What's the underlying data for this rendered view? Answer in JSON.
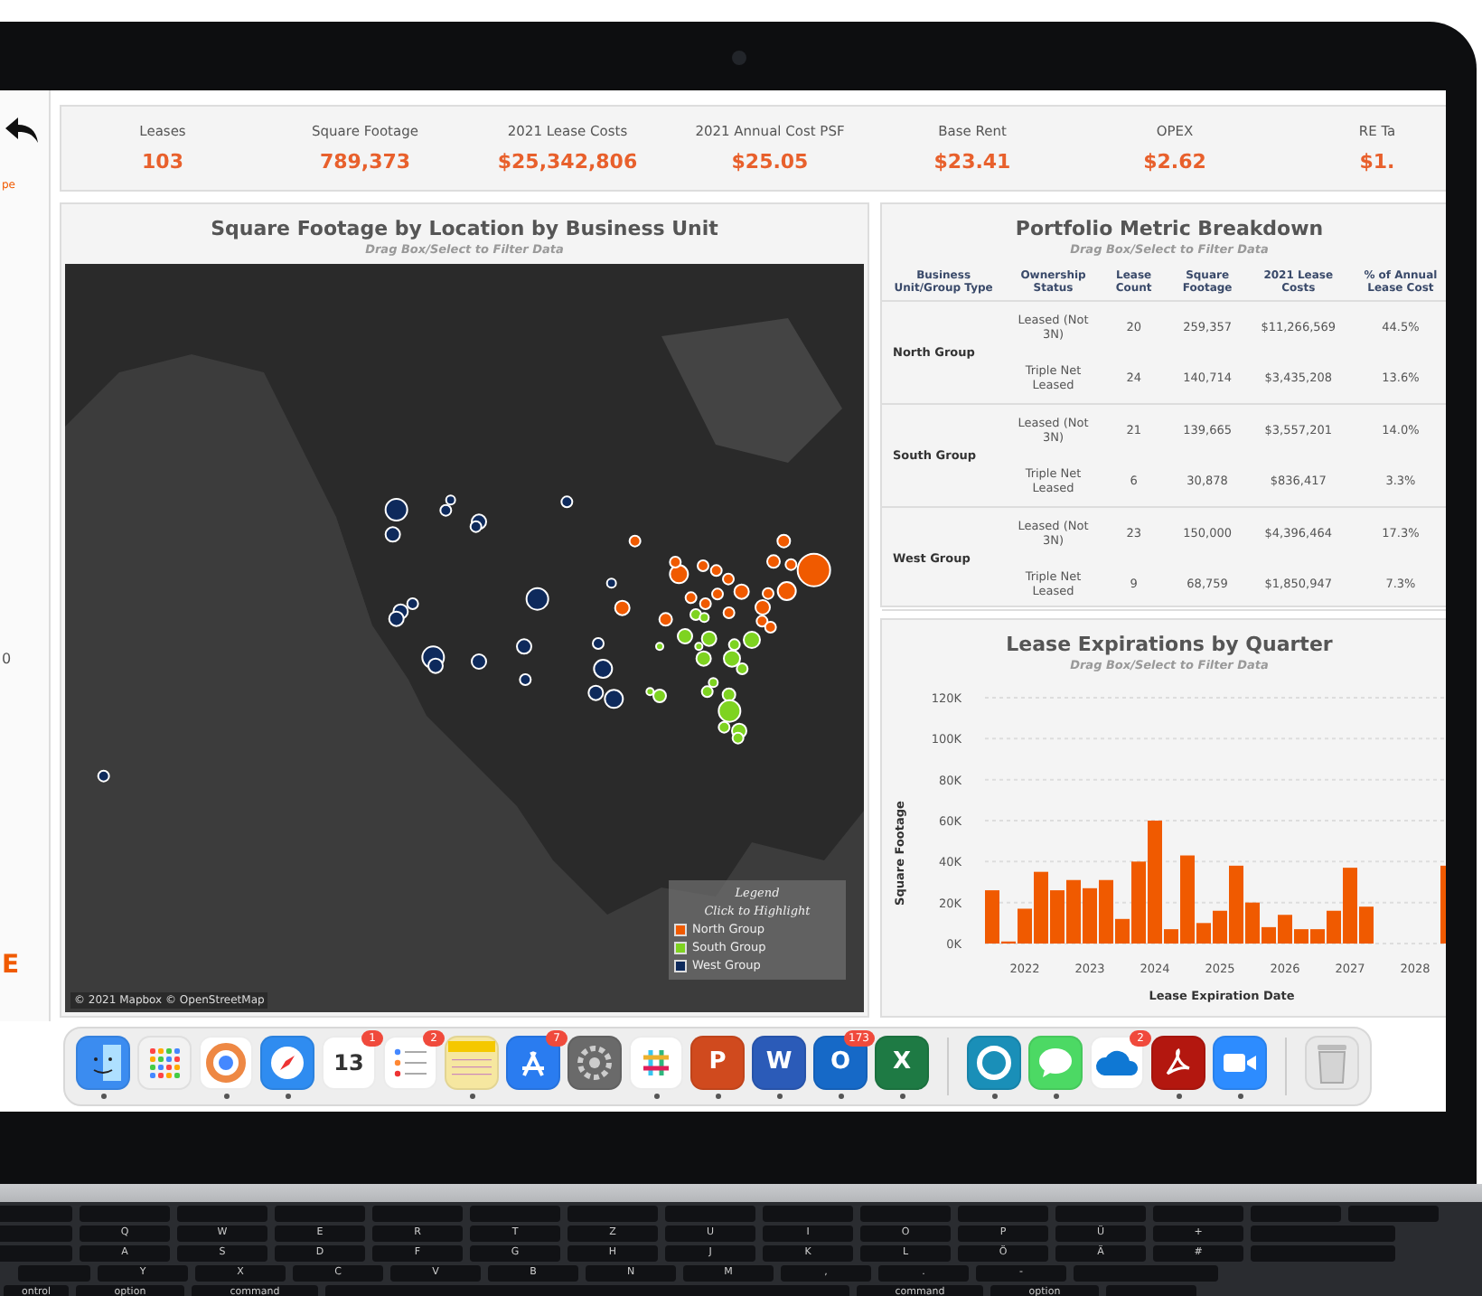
{
  "sidebar": {
    "texts": [
      {
        "text": "pe",
        "kind": "small"
      },
      {
        "text": "0",
        "kind": "plain"
      },
      {
        "text": "E",
        "kind": "big"
      }
    ]
  },
  "kpis": [
    {
      "label": "Leases",
      "value": "103"
    },
    {
      "label": "Square Footage",
      "value": "789,373"
    },
    {
      "label": "2021 Lease Costs",
      "value": "$25,342,806"
    },
    {
      "label": "2021 Annual Cost PSF",
      "value": "$25.05"
    },
    {
      "label": "Base Rent",
      "value": "$23.41"
    },
    {
      "label": "OPEX",
      "value": "$2.62"
    },
    {
      "label": "RE Ta",
      "value": "$1."
    }
  ],
  "map": {
    "title": "Square Footage by Location by Business Unit",
    "subtitle": "Drag Box/Select to Filter Data",
    "attribution": "© 2021 Mapbox © OpenStreetMap",
    "legend": {
      "title": "Legend",
      "hint": "Click to Highlight",
      "items": [
        {
          "label": "North Group",
          "color": "#f05a00"
        },
        {
          "label": "South Group",
          "color": "#7ed321"
        },
        {
          "label": "West Group",
          "color": "#0e2a5c"
        }
      ]
    }
  },
  "table": {
    "title": "Portfolio Metric Breakdown",
    "subtitle": "Drag Box/Select to Filter Data",
    "columns": [
      "Business Unit/Group Type",
      "Ownership Status",
      "Lease Count",
      "Square Footage",
      "2021 Lease Costs",
      "% of Annual Lease Cost"
    ],
    "groups": [
      {
        "name": "North Group",
        "rows": [
          [
            "Leased (Not 3N)",
            "20",
            "259,357",
            "$11,266,569",
            "44.5%"
          ],
          [
            "Triple Net Leased",
            "24",
            "140,714",
            "$3,435,208",
            "13.6%"
          ]
        ]
      },
      {
        "name": "South Group",
        "rows": [
          [
            "Leased (Not 3N)",
            "21",
            "139,665",
            "$3,557,201",
            "14.0%"
          ],
          [
            "Triple Net Leased",
            "6",
            "30,878",
            "$836,417",
            "3.3%"
          ]
        ]
      },
      {
        "name": "West Group",
        "rows": [
          [
            "Leased (Not 3N)",
            "23",
            "150,000",
            "$4,396,464",
            "17.3%"
          ],
          [
            "Triple Net Leased",
            "9",
            "68,759",
            "$1,850,947",
            "7.3%"
          ]
        ]
      }
    ]
  },
  "expirations": {
    "title": "Lease Expirations by Quarter",
    "subtitle": "Drag Box/Select to Filter Data",
    "chart_data": {
      "type": "bar",
      "xlabel": "Lease Expiration Date",
      "ylabel": "Square Footage",
      "grid": true,
      "categories": [
        null,
        null,
        "2022",
        null,
        null,
        null,
        "2023",
        null,
        null,
        null,
        "2024",
        null,
        null,
        null,
        "2025",
        null,
        null,
        null,
        "2026",
        null,
        null,
        null,
        "2027",
        null,
        null,
        null,
        "2028",
        null,
        null
      ],
      "series": [
        {
          "color": "#f05a00",
          "values": [
            26000,
            1000,
            17000,
            35000,
            26000,
            31000,
            27000,
            31000,
            12000,
            40000,
            60000,
            7000,
            43000,
            10000,
            16000,
            38000,
            20000,
            8000,
            14000,
            7000,
            7000,
            16000,
            37000,
            18000,
            null,
            null,
            null,
            null,
            38000
          ]
        }
      ],
      "ylim": [
        0,
        120000
      ],
      "yticks": [
        {
          "value": 0,
          "label": "0K"
        },
        {
          "value": 20000,
          "label": "20K"
        },
        {
          "value": 40000,
          "label": "40K"
        },
        {
          "value": 60000,
          "label": "60K"
        },
        {
          "value": 80000,
          "label": "80K"
        },
        {
          "value": 100000,
          "label": "100K"
        },
        {
          "value": 120000,
          "label": "120K"
        }
      ]
    }
  },
  "dock": [
    {
      "kind": "finder",
      "running": true
    },
    {
      "kind": "grid",
      "running": false
    },
    {
      "kind": "ring",
      "running": true
    },
    {
      "kind": "compass",
      "running": true
    },
    {
      "kind": "calendar",
      "letter": "13",
      "badge": "1",
      "running": false
    },
    {
      "kind": "list",
      "badge": "2",
      "running": false
    },
    {
      "kind": "notes",
      "running": true
    },
    {
      "kind": "appstore",
      "badge": "7",
      "running": false
    },
    {
      "kind": "gear",
      "running": false
    },
    {
      "kind": "hash",
      "running": true
    },
    {
      "kind": "presentation",
      "letter": "P",
      "running": true
    },
    {
      "kind": "document",
      "letter": "W",
      "running": true
    },
    {
      "kind": "mail",
      "letter": "O",
      "badge": "173",
      "running": true
    },
    {
      "kind": "spreadsheet",
      "letter": "X",
      "running": true
    },
    {
      "kind": "separator"
    },
    {
      "kind": "circle",
      "running": true
    },
    {
      "kind": "bubble",
      "running": true
    },
    {
      "kind": "cloud",
      "badge": "2",
      "running": false
    },
    {
      "kind": "pdf",
      "running": true
    },
    {
      "kind": "camera",
      "running": true
    },
    {
      "kind": "separator"
    },
    {
      "kind": "trash",
      "running": false
    }
  ],
  "keyboard": {
    "rows": [
      [
        "Q",
        "W",
        "E",
        "R",
        "T",
        "Z",
        "U",
        "I",
        "O",
        "P",
        "Ü",
        "+"
      ],
      [
        "A",
        "S",
        "D",
        "F",
        "G",
        "H",
        "J",
        "K",
        "L",
        "Ö",
        "Ä",
        "#"
      ],
      [
        "Y",
        "X",
        "C",
        "V",
        "B",
        "N",
        "M",
        ",",
        ".",
        "-"
      ]
    ],
    "bottom_left": [
      "ontrol",
      "option",
      "command"
    ],
    "bottom_right": [
      "command",
      "option"
    ]
  }
}
